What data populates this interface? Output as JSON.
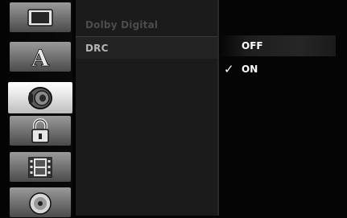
{
  "sidebar": {
    "items": [
      {
        "id": "display",
        "icon": "tv-icon",
        "active": false
      },
      {
        "id": "language",
        "icon": "language-a-icon",
        "active": false
      },
      {
        "id": "audio",
        "icon": "speaker-icon",
        "active": true
      },
      {
        "id": "lock",
        "icon": "padlock-icon",
        "active": false
      },
      {
        "id": "recording",
        "icon": "film-icon",
        "active": false
      },
      {
        "id": "disc",
        "icon": "disc-icon",
        "active": false
      }
    ],
    "language_glyph": "A"
  },
  "menu": {
    "items": [
      {
        "label": "Dolby Digital",
        "state": "dim"
      },
      {
        "label": "DRC",
        "state": "selected"
      }
    ]
  },
  "options": {
    "items": [
      {
        "label": "OFF",
        "highlighted": true,
        "checked": false
      },
      {
        "label": "ON",
        "highlighted": false,
        "checked": true
      }
    ],
    "check_glyph": "✓"
  }
}
